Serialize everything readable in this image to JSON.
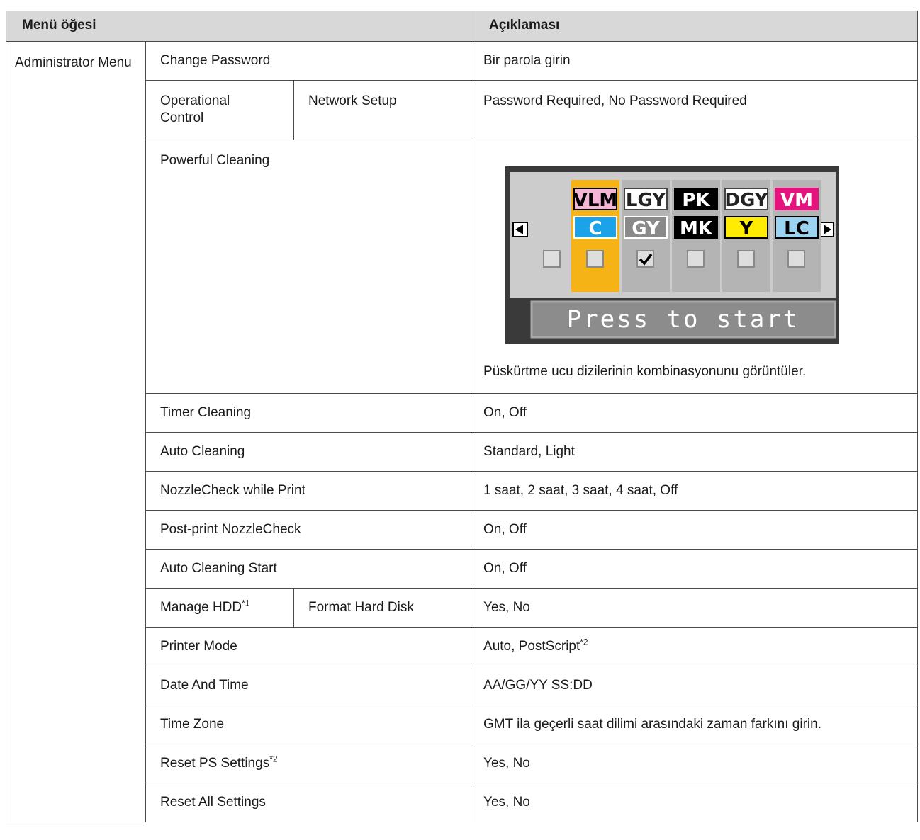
{
  "header": {
    "col_menu": "Menü öğesi",
    "col_desc": "Açıklaması"
  },
  "group": {
    "label": "Administrator Menu"
  },
  "rows": {
    "change_password": {
      "item": "Change Password",
      "desc": "Bir parola girin"
    },
    "operational_control": {
      "item": "Operational Control",
      "sub": "Network Setup",
      "desc": "Password Required, No Password Required"
    },
    "powerful_cleaning": {
      "item": "Powerful Cleaning",
      "desc": "Püskürtme ucu dizilerinin kombinasyonunu görüntüler."
    },
    "timer_cleaning": {
      "item": "Timer Cleaning",
      "desc": "On, Off"
    },
    "auto_cleaning": {
      "item": "Auto Cleaning",
      "desc": "Standard, Light"
    },
    "nozzle_check_print": {
      "item": "NozzleCheck while Print",
      "desc": "1 saat, 2 saat, 3 saat, 4 saat, Off"
    },
    "post_print_nozzle": {
      "item": "Post-print NozzleCheck",
      "desc": "On, Off"
    },
    "auto_cleaning_start": {
      "item": "Auto Cleaning Start",
      "desc": "On, Off"
    },
    "manage_hdd": {
      "item": "Manage HDD",
      "item_sup": "*1",
      "sub": "Format Hard Disk",
      "desc": "Yes, No"
    },
    "printer_mode": {
      "item": "Printer Mode",
      "desc": "Auto, PostScript",
      "desc_sup": "*2"
    },
    "date_time": {
      "item": "Date And Time",
      "desc": "AA/GG/YY SS:DD"
    },
    "time_zone": {
      "item": "Time Zone",
      "desc": "GMT ila geçerli saat dilimi arasındaki zaman farkını girin."
    },
    "reset_ps": {
      "item": "Reset PS Settings",
      "item_sup": "*2",
      "desc": "Yes, No"
    },
    "reset_all": {
      "item": "Reset All Settings",
      "desc": "Yes, No"
    }
  },
  "lcd": {
    "start_label": "Press to start",
    "colors": {
      "panel_bg": "#3a3a3a",
      "slot_bg": "#b4b4b4",
      "selected": "#f5b316",
      "vlm": "#f4b5d7",
      "cyan": "#1aa3e8",
      "yellow": "#ffec00",
      "vm": "#e5137e",
      "lc": "#9bd3f0"
    },
    "slots": [
      {
        "top": "VLM",
        "bottom": "C",
        "checked": false,
        "selected": true
      },
      {
        "top": "LGY",
        "bottom": "GY",
        "checked": true,
        "selected": false
      },
      {
        "top": "PK",
        "bottom": "MK",
        "checked": false,
        "selected": false
      },
      {
        "top": "DGY",
        "bottom": "Y",
        "checked": false,
        "selected": false
      },
      {
        "top": "VM",
        "bottom": "LC",
        "checked": false,
        "selected": false
      }
    ],
    "icons": {
      "left": "arrow-left-icon",
      "right": "arrow-right-icon",
      "check": "checkmark-icon"
    }
  }
}
